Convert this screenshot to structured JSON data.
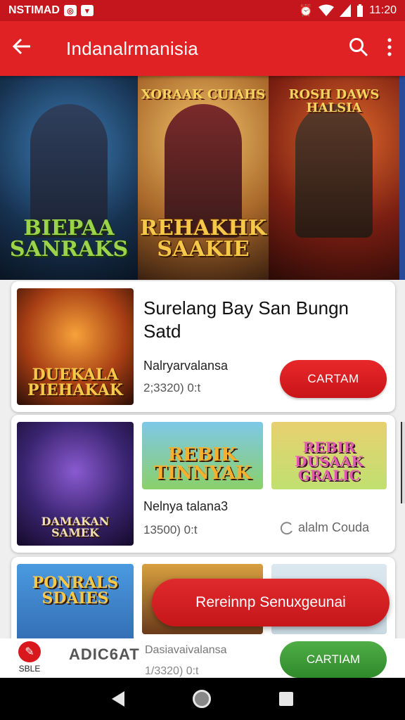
{
  "status_bar": {
    "carrier": "NSTIMAD",
    "time": "11:20"
  },
  "app_bar": {
    "title": "Indanalrmanisia"
  },
  "banner": {
    "posters": [
      {
        "top_text": "",
        "bottom_text": "BIEPAA SANRAKS"
      },
      {
        "top_text": "XORAAK CUIAHS",
        "bottom_text": "REHAKHK SAAKIE"
      },
      {
        "top_text": "ROSH DAWS HALSIA",
        "bottom_text": ""
      }
    ]
  },
  "cards": [
    {
      "title": "Surelang Bay San Bungn Satd",
      "thumb_text": "DUEKALA PIEHAKAK",
      "subtitle": "Nalryarvalansa",
      "meta": "2;3320) 0:t",
      "button": "CARTAM"
    },
    {
      "thumbs": [
        "DAMAKAN SAMEK",
        "REBIK TINNYAK",
        "REBIR DUSAAK GRALIC"
      ],
      "subtitle": "Nelnya talana3",
      "meta": "13500) 0:t",
      "link": "alalm Couda"
    },
    {
      "thumbs": [
        "PONRALS SDAIES",
        "",
        ""
      ],
      "subtitle": "Dasiavaivalansa",
      "meta": "1/3320) 0:t"
    }
  ],
  "fab": {
    "label": "Rereinnp Senuxgeunai"
  },
  "bottom_strip": {
    "sale_label": "SBLE",
    "brand": "ADIC6AT",
    "button": "CARTIAM"
  },
  "colors": {
    "primary": "#e02225",
    "status": "#c4161c",
    "green": "#3a9a34"
  }
}
